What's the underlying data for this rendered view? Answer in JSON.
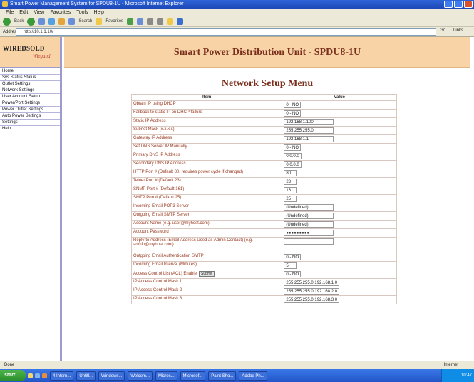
{
  "window": {
    "title": "Smart Power Management System for SPDU8-1U - Microsoft Internet Explorer"
  },
  "menubar": {
    "items": [
      "File",
      "Edit",
      "View",
      "Favorites",
      "Tools",
      "Help"
    ]
  },
  "toolbar": {
    "back_label": "Back",
    "search_label": "Search",
    "favorites_label": "Favorites"
  },
  "address": {
    "label": "Address",
    "url": "http://10.1.1.10/",
    "go_label": "Go",
    "links_label": "Links"
  },
  "sidebar": {
    "logo_brand": "WIREDSOLD",
    "logo_tagline": "Wiegand",
    "items": [
      {
        "label": "Home"
      },
      {
        "label": "Sys Status Status"
      },
      {
        "label": "Outlet Settings"
      },
      {
        "label": "Network Settings"
      },
      {
        "label": "User Account Setup"
      },
      {
        "label": "Power/Port Settings"
      },
      {
        "label": "Power Outlet Settings"
      },
      {
        "label": "Auto Power Settings"
      },
      {
        "label": "Settings"
      },
      {
        "label": "Help"
      }
    ]
  },
  "banner": {
    "title": "Smart Power Distribution Unit - SPDU8-1U"
  },
  "page": {
    "title": "Network Setup Menu"
  },
  "table": {
    "headers": [
      "Item",
      "Value"
    ],
    "rows": [
      {
        "item": "Obtain IP using DHCP",
        "value": "0 - NO"
      },
      {
        "item": "Fallback to static IP on DHCP failure",
        "value": "0 - NO"
      },
      {
        "item": "Static IP Address",
        "value": "192.168.1.100"
      },
      {
        "item": "Subnet Mask (x.x.x.x)",
        "value": "255.255.255.0"
      },
      {
        "item": "Gateway IP Address",
        "value": "192.168.1.1"
      },
      {
        "item": "Set DNS Server IP Manually",
        "value": "0 - NO"
      },
      {
        "item": "Primary DNS IP Address",
        "value": "0.0.0.0"
      },
      {
        "item": "Secondary DNS IP Address",
        "value": "0.0.0.0"
      },
      {
        "item": "HTTP Port # (Default 80, requires power cycle if changed)",
        "value": "80"
      },
      {
        "item": "Telnet Port # (Default 23)",
        "value": "23"
      },
      {
        "item": "SNMP Port # (Default 161)",
        "value": "161"
      },
      {
        "item": "SMTP Port # (Default 25)",
        "value": "25"
      },
      {
        "item": "Incoming Email POP3 Server",
        "value": "(Undefined)"
      },
      {
        "item": "Outgoing Email SMTP Server",
        "value": "(Undefined)"
      },
      {
        "item": "Account Name (e.g. user@myhost.com)",
        "value": "(Undefined)"
      },
      {
        "item": "Account Password",
        "value": "●●●●●●●●●"
      },
      {
        "item": "Reply-to Address (Email Address Used as Admin Contact) (e.g. admin@myhost.com)",
        "value": ""
      },
      {
        "item": "Outgoing Email Authentication SMTP",
        "value": "0 - NO"
      },
      {
        "item": "Incoming Email Interval (Minutes)",
        "value": "5"
      },
      {
        "item": "Access Control List (ACL) Enable",
        "value": "0 - NO",
        "button": "Submit"
      },
      {
        "item": "IP Access Control Mask 1",
        "value": "255.255.255.0  192.168.1.0"
      },
      {
        "item": "IP Access Control Mask 2",
        "value": "255.255.255.0  192.168.2.0"
      },
      {
        "item": "IP Access Control Mask 3",
        "value": "255.255.255.0  192.168.3.0"
      }
    ]
  },
  "statusbar": {
    "left": "Done",
    "right": "Internet"
  },
  "taskbar": {
    "start_label": "start",
    "tasks": [
      "4 Intern...",
      "Untitl...",
      "Windows...",
      "Welcom...",
      "Micros...",
      "Microsof...",
      "Paint Sho...",
      "Adobe Ph..."
    ],
    "clock": "10:47"
  },
  "colors": {
    "banner_bg": "#f7d3a6",
    "title_text": "#7a2e1c",
    "sidebar_border": "#9b9bd1",
    "item_text": "#9a3b22"
  }
}
